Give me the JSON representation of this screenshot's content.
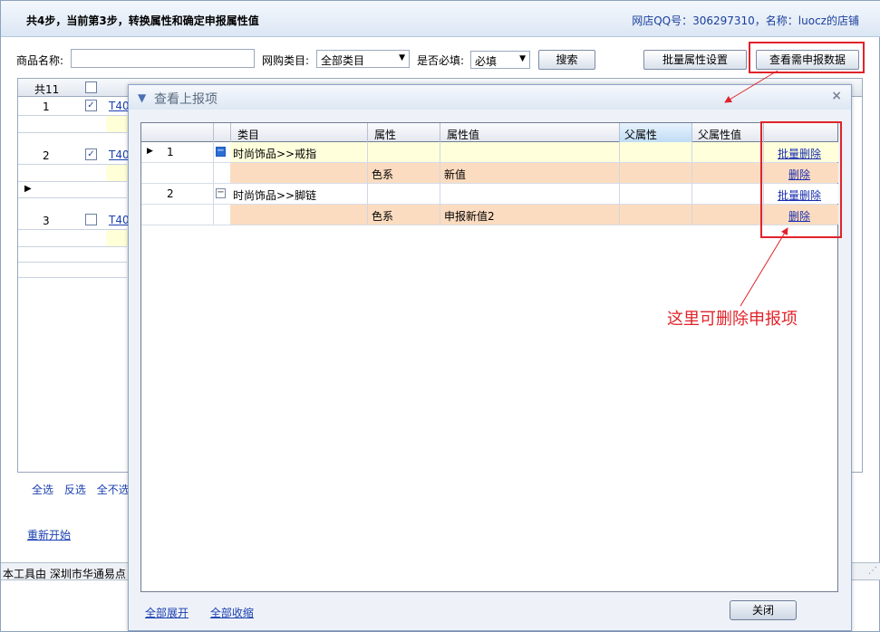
{
  "header": {
    "step_title": "共4步，当前第3步，转换属性和确定申报属性值",
    "shop_info": "网店QQ号：306297310，名称：luocz的店铺"
  },
  "filters": {
    "name_label": "商品名称:",
    "name_value": "",
    "category_label": "网购类目:",
    "category_value": "全部类目",
    "required_label": "是否必填:",
    "required_value": "必填",
    "search_button": "搜索",
    "batch_attr_button": "批量属性设置",
    "view_declare_button": "查看需申报数据"
  },
  "background_grid": {
    "count": "共11",
    "rows": [
      {
        "num": "1",
        "checked": true,
        "link": "T40"
      },
      {
        "num": "2",
        "checked": true,
        "link": "T40"
      },
      {
        "num": "3",
        "checked": false,
        "link": "T40"
      }
    ],
    "select_all": "全选",
    "invert": "反选",
    "select_none": "全不选",
    "restart": "重新开始",
    "footer_text": "本工具由 深圳市华通易点"
  },
  "dialog": {
    "title": "查看上报项",
    "columns": [
      "类目",
      "属性",
      "属性值",
      "父属性",
      "父属性值"
    ],
    "rows": [
      {
        "num": "1",
        "category": "时尚饰品>>戒指",
        "attr": "",
        "value": "",
        "action": "批量删除",
        "expander": "−"
      },
      {
        "num": "",
        "category": "",
        "attr": "色系",
        "value": "新值",
        "action": "删除"
      },
      {
        "num": "2",
        "category": "时尚饰品>>脚链",
        "attr": "",
        "value": "",
        "action": "批量删除",
        "expander": "−"
      },
      {
        "num": "",
        "category": "",
        "attr": "色系",
        "value": "申报新值2",
        "action": "删除"
      }
    ],
    "expand_all": "全部展开",
    "collapse_all": "全部收缩",
    "close_button": "关闭"
  },
  "annotation": {
    "note": "这里可删除申报项",
    "color": "#e0232a"
  }
}
